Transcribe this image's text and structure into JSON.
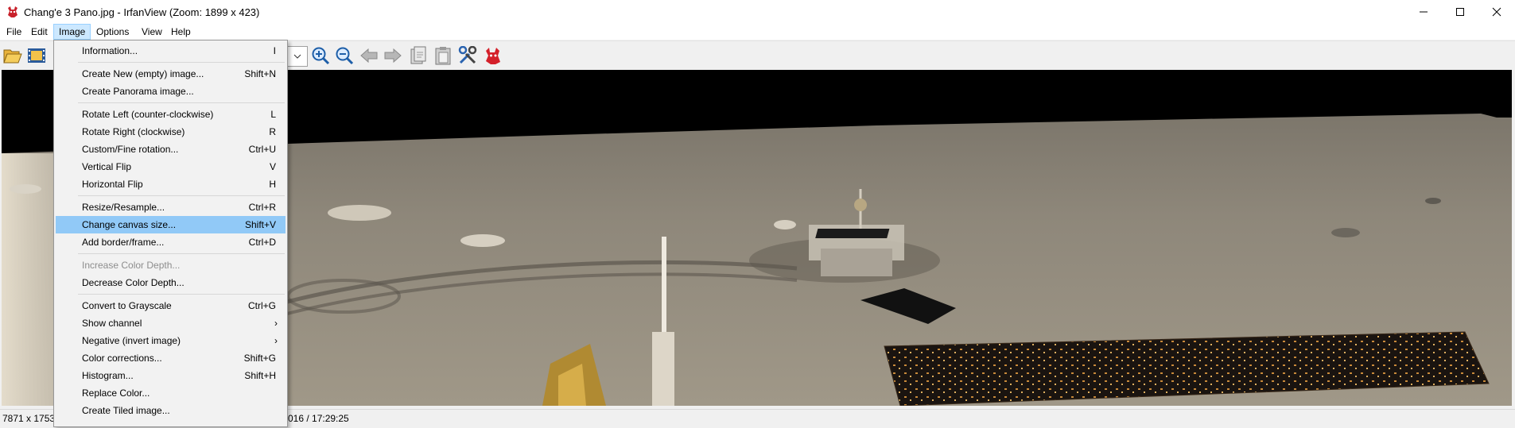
{
  "window": {
    "title": "Chang'e 3 Pano.jpg - IrfanView (Zoom: 1899 x 423)",
    "minimize_icon": "minimize-icon",
    "maximize_icon": "maximize-icon",
    "close_icon": "close-icon"
  },
  "menubar": {
    "items": [
      "File",
      "Edit",
      "Image",
      "Options",
      "View",
      "Help"
    ],
    "active": "Image"
  },
  "toolbar": {
    "icons": [
      "open-folder-icon",
      "filmstrip-icon",
      "zoom-in-icon",
      "zoom-out-icon",
      "previous-icon",
      "next-icon",
      "copy-icon",
      "paste-icon",
      "settings-icon",
      "irfanview-cat-icon"
    ]
  },
  "image_menu": {
    "items": [
      {
        "label": "Information...",
        "shortcut": "I"
      },
      {
        "label": "Create New (empty) image...",
        "shortcut": "Shift+N"
      },
      {
        "label": "Create Panorama image...",
        "shortcut": ""
      },
      {
        "label": "Rotate Left (counter-clockwise)",
        "shortcut": "L"
      },
      {
        "label": "Rotate Right (clockwise)",
        "shortcut": "R"
      },
      {
        "label": "Custom/Fine rotation...",
        "shortcut": "Ctrl+U"
      },
      {
        "label": "Vertical Flip",
        "shortcut": "V"
      },
      {
        "label": "Horizontal Flip",
        "shortcut": "H"
      },
      {
        "label": "Resize/Resample...",
        "shortcut": "Ctrl+R"
      },
      {
        "label": "Change canvas size...",
        "shortcut": "Shift+V",
        "highlighted": true
      },
      {
        "label": "Add border/frame...",
        "shortcut": "Ctrl+D"
      },
      {
        "label": "Increase Color Depth...",
        "shortcut": "",
        "disabled": true
      },
      {
        "label": "Decrease Color Depth...",
        "shortcut": ""
      },
      {
        "label": "Convert to Grayscale",
        "shortcut": "Ctrl+G"
      },
      {
        "label": "Show channel",
        "shortcut": "",
        "submenu": true
      },
      {
        "label": "Negative (invert image)",
        "shortcut": "",
        "submenu": true
      },
      {
        "label": "Color corrections...",
        "shortcut": "Shift+G"
      },
      {
        "label": "Histogram...",
        "shortcut": "Shift+H"
      },
      {
        "label": "Replace Color...",
        "shortcut": ""
      },
      {
        "label": "Create Tiled image...",
        "shortcut": ""
      }
    ],
    "submenu_arrow": "›"
  },
  "statusbar": {
    "dimensions": "7871 x 1753 :",
    "datetime": "016 / 17:29:25"
  },
  "colors": {
    "menu_highlight": "#91c9f7",
    "menubar_active": "#cce8ff",
    "lunar_surface": "#8f8778",
    "sky": "#000000"
  }
}
